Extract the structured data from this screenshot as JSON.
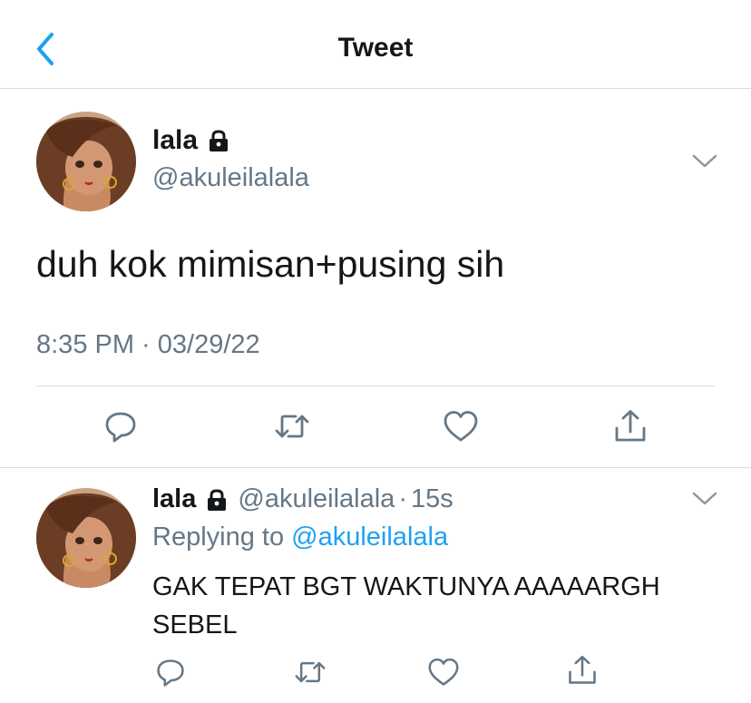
{
  "header": {
    "title": "Tweet",
    "back_icon": "chevron-left-icon",
    "accent": "#1da1f2"
  },
  "tweet": {
    "name": "lala",
    "handle": "@akuleilalala",
    "text": "duh kok mimisan+pusing sih",
    "time": "8:35 PM",
    "date": "03/29/22",
    "meta_sep": " · ",
    "actions": [
      "reply-icon",
      "retweet-icon",
      "like-icon",
      "share-icon"
    ]
  },
  "reply": {
    "name": "lala",
    "handle": "@akuleilalala",
    "age": "15s",
    "dot": "·",
    "replying_prefix": "Replying to ",
    "replying_to": "@akuleilalala",
    "text": "GAK TEPAT BGT WAKTUNYA AAAAARGH SEBEL",
    "actions": [
      "reply-icon",
      "retweet-icon",
      "like-icon",
      "share-icon"
    ]
  },
  "colors": {
    "text": "#14171a",
    "secondary": "#657786",
    "link": "#1da1f2",
    "divider": "#d9dde1"
  }
}
